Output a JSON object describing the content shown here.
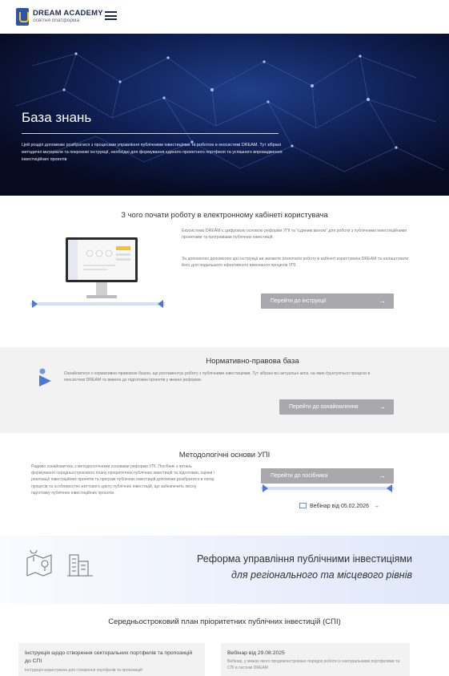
{
  "header": {
    "brand_name": "DREAM ACADEMY",
    "brand_sub": "освітня платформа"
  },
  "hero": {
    "title": "База знань",
    "text": "Цей розділ допоможе розібратися з процесами управління публічними інвестиціями та роботою в екосистемі DREAM. Тут зібрані методичні матеріали та покрокові інструкції, необхідні для формування єдиного проектного портфеля та успішного впровадження інвестиційних проектів"
  },
  "section_start": {
    "title": "З чого почати роботу в електронному кабінеті користувача",
    "p1": "Екосистема DREAM є цифровою основою реформи УПІ та \"єдиним вікном\" для роботи з публічними інвестиційними проектами та програмами публічних інвестицій.",
    "p2": "За допомогою допомогою цієї інструкції ви зможете розпочати роботу в кабінеті користувача DREAM та налаштувати його для подальшого ефективного виконання процесів УПІ.",
    "button": "Перейти до інструкції",
    "arrow": "→"
  },
  "section_legal": {
    "title": "Нормативно-правова база",
    "text": "Ознайомтеся з нормативно-правовою базою, що регламентує роботу з публічними інвестиціями. Тут зібрані всі актуальні акти, на яких ґрунтуються процеси в екосистемі DREAM та вимоги до підготовки проектів у межах реформи.",
    "button": "Перейти до ознайомлення",
    "arrow": "→"
  },
  "section_method": {
    "title": "Методологічні основи УПІ",
    "text": "Радимо ознайомитись з методологічними основами реформи УПІ. Посібник з питань формування середньострокового плану пріоритетних публічних інвестицій та підготовки, оцінки і реалізації інвестиційних проектів та програм публічних інвестицій допоможе розібратися в логіці процесів та особливостях життєвого циклу публічних інвестицій, що забезпечить якісну підготовку публічних інвестиційних проєктів.",
    "button": "Перейти до посібника",
    "arrow": "→",
    "webinar": "Вебінар від 05.02.2026",
    "webinar_arrow": "→"
  },
  "reform": {
    "title": "Реформа управління публічними інвестиціями",
    "subtitle": "для регіонального та місцевого рівнів"
  },
  "section_spi": {
    "title": "Середньостроковий план пріоритетних публічних інвестицій (СПІ)",
    "card1_title": "Інструкція щодо створення секторальних портфелів та пропозицій до СПІ",
    "card1_text": "Інструкція користувача для створення портфелів та пропозицій",
    "card2_title": "Вебінар від 29.08.2025",
    "card2_text": "Вебінар, у межах якого продемонстровано порядок роботи із секторальними портфелями та СПІ в системі DREAM"
  },
  "colors": {
    "accent": "#2f55a4",
    "button_gray": "#a9a9ad",
    "hero_bg": "#0a1230",
    "section_gray": "#f2f2f2"
  }
}
